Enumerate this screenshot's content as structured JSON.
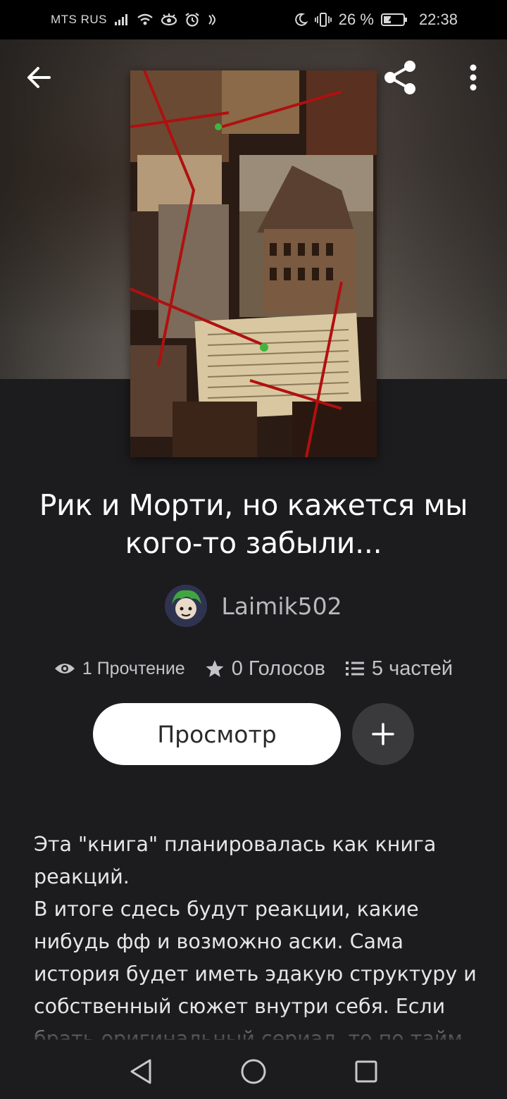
{
  "status_bar": {
    "carrier": "MTS RUS",
    "battery": "26 %",
    "time": "22:38",
    "icons": [
      "signal-icon",
      "wifi-icon",
      "eye-icon",
      "alarm-icon",
      "nfc-icon",
      "moon-icon",
      "vibrate-icon",
      "battery-icon"
    ]
  },
  "toolbar": {
    "back_icon": "arrow-left-icon",
    "share_icon": "share-icon",
    "more_icon": "more-vertical-icon"
  },
  "story": {
    "title": "Рик и Морти, но кажется мы кого-то забыли...",
    "author": "Laimik502",
    "stats": {
      "reads": "1 Прочтение",
      "votes": "0 Голосов",
      "parts": "5 частей"
    }
  },
  "actions": {
    "view_label": "Просмотр",
    "add_icon": "plus-icon"
  },
  "description": [
    "Эта \"книга\" планировалась как книга реакций.",
    "В итоге сдесь будут реакции, какие нибудь фф и возможно аски. Сама история будет иметь эдакую структуру и собственный сюжет внутри себя. Если брать оригинальный сериал, то по тайм"
  ],
  "nav_bar": {
    "icons": [
      "back-triangle-icon",
      "home-circle-icon",
      "recents-square-icon"
    ]
  },
  "colors": {
    "background": "#1c1b1d",
    "primary_button": "#ffffff",
    "secondary_button": "#3a3a3d",
    "muted_text": "#c4c4c8"
  }
}
